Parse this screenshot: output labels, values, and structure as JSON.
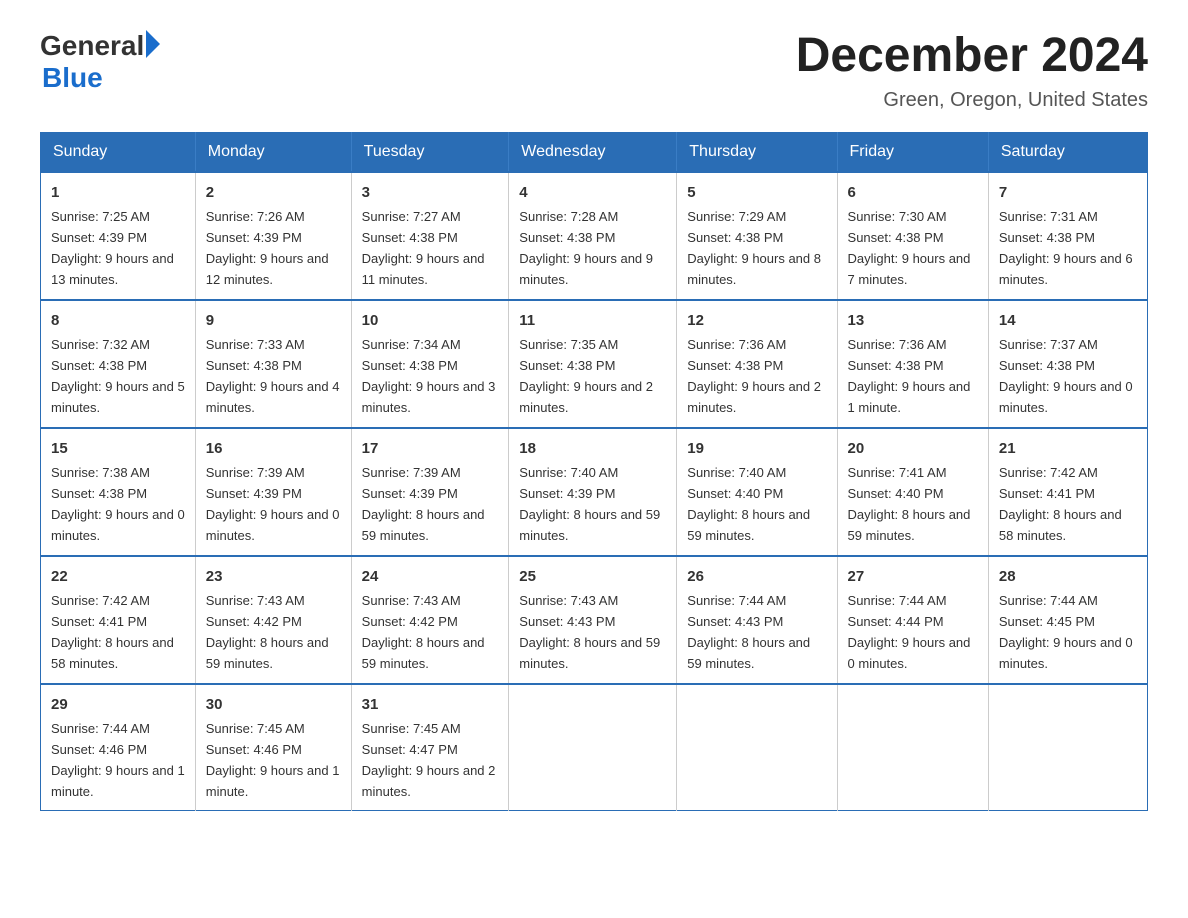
{
  "logo": {
    "general": "General",
    "blue": "Blue"
  },
  "title": "December 2024",
  "subtitle": "Green, Oregon, United States",
  "weekdays": [
    "Sunday",
    "Monday",
    "Tuesday",
    "Wednesday",
    "Thursday",
    "Friday",
    "Saturday"
  ],
  "weeks": [
    [
      {
        "day": "1",
        "sunrise": "7:25 AM",
        "sunset": "4:39 PM",
        "daylight": "9 hours and 13 minutes."
      },
      {
        "day": "2",
        "sunrise": "7:26 AM",
        "sunset": "4:39 PM",
        "daylight": "9 hours and 12 minutes."
      },
      {
        "day": "3",
        "sunrise": "7:27 AM",
        "sunset": "4:38 PM",
        "daylight": "9 hours and 11 minutes."
      },
      {
        "day": "4",
        "sunrise": "7:28 AM",
        "sunset": "4:38 PM",
        "daylight": "9 hours and 9 minutes."
      },
      {
        "day": "5",
        "sunrise": "7:29 AM",
        "sunset": "4:38 PM",
        "daylight": "9 hours and 8 minutes."
      },
      {
        "day": "6",
        "sunrise": "7:30 AM",
        "sunset": "4:38 PM",
        "daylight": "9 hours and 7 minutes."
      },
      {
        "day": "7",
        "sunrise": "7:31 AM",
        "sunset": "4:38 PM",
        "daylight": "9 hours and 6 minutes."
      }
    ],
    [
      {
        "day": "8",
        "sunrise": "7:32 AM",
        "sunset": "4:38 PM",
        "daylight": "9 hours and 5 minutes."
      },
      {
        "day": "9",
        "sunrise": "7:33 AM",
        "sunset": "4:38 PM",
        "daylight": "9 hours and 4 minutes."
      },
      {
        "day": "10",
        "sunrise": "7:34 AM",
        "sunset": "4:38 PM",
        "daylight": "9 hours and 3 minutes."
      },
      {
        "day": "11",
        "sunrise": "7:35 AM",
        "sunset": "4:38 PM",
        "daylight": "9 hours and 2 minutes."
      },
      {
        "day": "12",
        "sunrise": "7:36 AM",
        "sunset": "4:38 PM",
        "daylight": "9 hours and 2 minutes."
      },
      {
        "day": "13",
        "sunrise": "7:36 AM",
        "sunset": "4:38 PM",
        "daylight": "9 hours and 1 minute."
      },
      {
        "day": "14",
        "sunrise": "7:37 AM",
        "sunset": "4:38 PM",
        "daylight": "9 hours and 0 minutes."
      }
    ],
    [
      {
        "day": "15",
        "sunrise": "7:38 AM",
        "sunset": "4:38 PM",
        "daylight": "9 hours and 0 minutes."
      },
      {
        "day": "16",
        "sunrise": "7:39 AM",
        "sunset": "4:39 PM",
        "daylight": "9 hours and 0 minutes."
      },
      {
        "day": "17",
        "sunrise": "7:39 AM",
        "sunset": "4:39 PM",
        "daylight": "8 hours and 59 minutes."
      },
      {
        "day": "18",
        "sunrise": "7:40 AM",
        "sunset": "4:39 PM",
        "daylight": "8 hours and 59 minutes."
      },
      {
        "day": "19",
        "sunrise": "7:40 AM",
        "sunset": "4:40 PM",
        "daylight": "8 hours and 59 minutes."
      },
      {
        "day": "20",
        "sunrise": "7:41 AM",
        "sunset": "4:40 PM",
        "daylight": "8 hours and 59 minutes."
      },
      {
        "day": "21",
        "sunrise": "7:42 AM",
        "sunset": "4:41 PM",
        "daylight": "8 hours and 58 minutes."
      }
    ],
    [
      {
        "day": "22",
        "sunrise": "7:42 AM",
        "sunset": "4:41 PM",
        "daylight": "8 hours and 58 minutes."
      },
      {
        "day": "23",
        "sunrise": "7:43 AM",
        "sunset": "4:42 PM",
        "daylight": "8 hours and 59 minutes."
      },
      {
        "day": "24",
        "sunrise": "7:43 AM",
        "sunset": "4:42 PM",
        "daylight": "8 hours and 59 minutes."
      },
      {
        "day": "25",
        "sunrise": "7:43 AM",
        "sunset": "4:43 PM",
        "daylight": "8 hours and 59 minutes."
      },
      {
        "day": "26",
        "sunrise": "7:44 AM",
        "sunset": "4:43 PM",
        "daylight": "8 hours and 59 minutes."
      },
      {
        "day": "27",
        "sunrise": "7:44 AM",
        "sunset": "4:44 PM",
        "daylight": "9 hours and 0 minutes."
      },
      {
        "day": "28",
        "sunrise": "7:44 AM",
        "sunset": "4:45 PM",
        "daylight": "9 hours and 0 minutes."
      }
    ],
    [
      {
        "day": "29",
        "sunrise": "7:44 AM",
        "sunset": "4:46 PM",
        "daylight": "9 hours and 1 minute."
      },
      {
        "day": "30",
        "sunrise": "7:45 AM",
        "sunset": "4:46 PM",
        "daylight": "9 hours and 1 minute."
      },
      {
        "day": "31",
        "sunrise": "7:45 AM",
        "sunset": "4:47 PM",
        "daylight": "9 hours and 2 minutes."
      },
      null,
      null,
      null,
      null
    ]
  ],
  "labels": {
    "sunrise": "Sunrise:",
    "sunset": "Sunset:",
    "daylight": "Daylight:"
  }
}
